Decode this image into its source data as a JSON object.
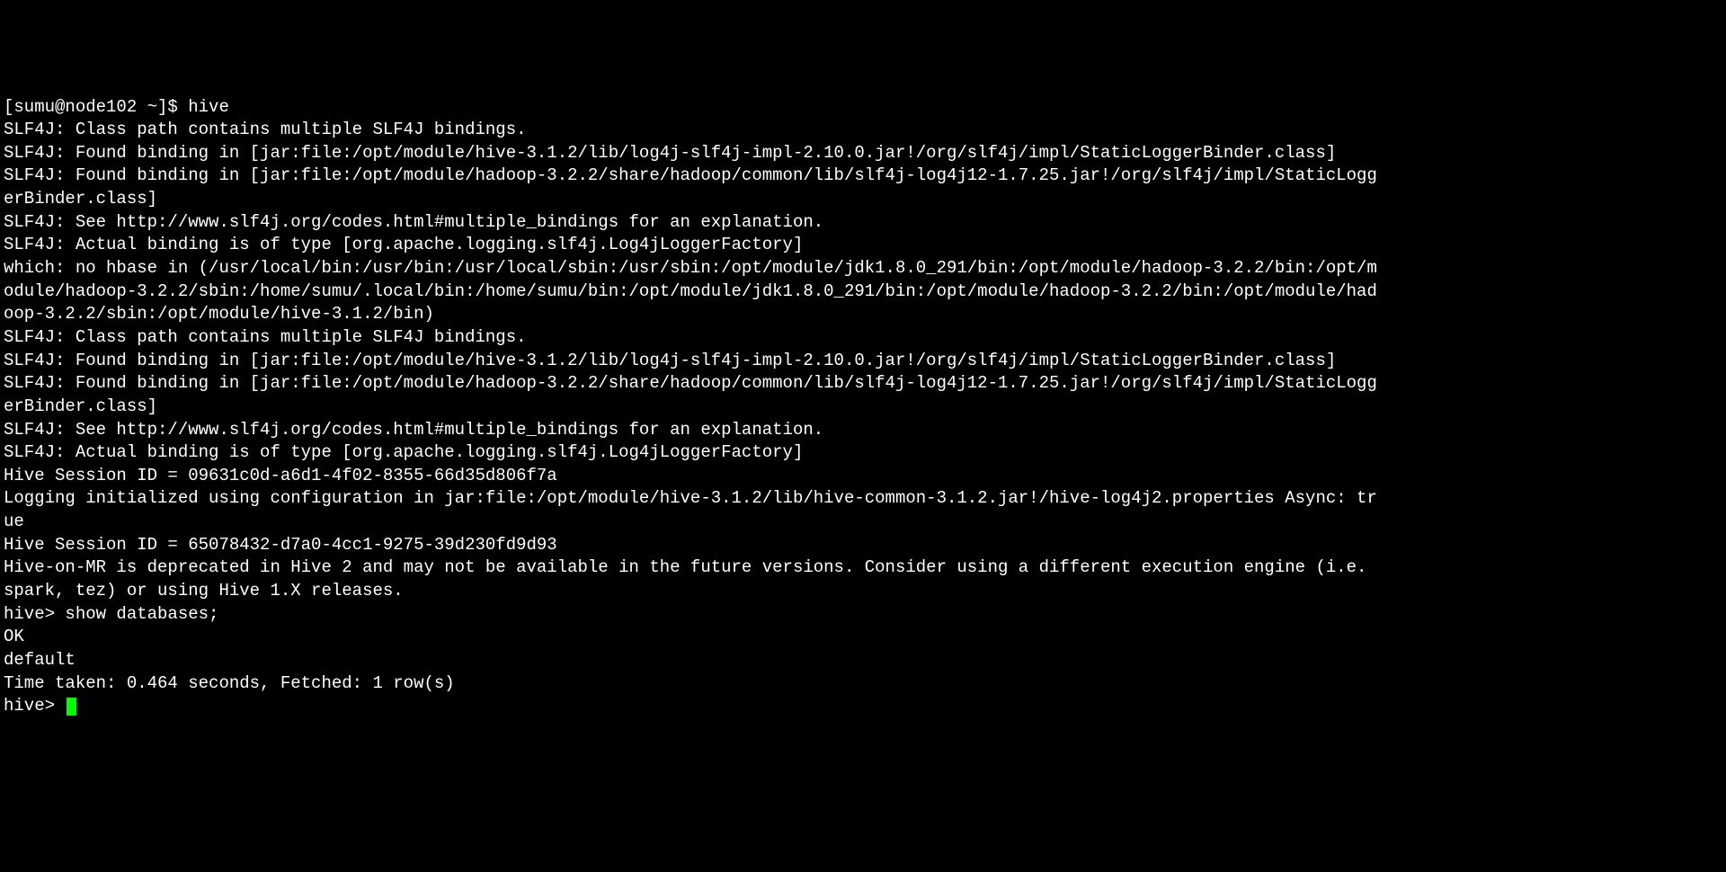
{
  "terminal": {
    "lines": [
      "[sumu@node102 ~]$ hive",
      "SLF4J: Class path contains multiple SLF4J bindings.",
      "SLF4J: Found binding in [jar:file:/opt/module/hive-3.1.2/lib/log4j-slf4j-impl-2.10.0.jar!/org/slf4j/impl/StaticLoggerBinder.class]",
      "SLF4J: Found binding in [jar:file:/opt/module/hadoop-3.2.2/share/hadoop/common/lib/slf4j-log4j12-1.7.25.jar!/org/slf4j/impl/StaticLoggerBinder.class]",
      "SLF4J: See http://www.slf4j.org/codes.html#multiple_bindings for an explanation.",
      "SLF4J: Actual binding is of type [org.apache.logging.slf4j.Log4jLoggerFactory]",
      "which: no hbase in (/usr/local/bin:/usr/bin:/usr/local/sbin:/usr/sbin:/opt/module/jdk1.8.0_291/bin:/opt/module/hadoop-3.2.2/bin:/opt/module/hadoop-3.2.2/sbin:/home/sumu/.local/bin:/home/sumu/bin:/opt/module/jdk1.8.0_291/bin:/opt/module/hadoop-3.2.2/bin:/opt/module/hadoop-3.2.2/sbin:/opt/module/hive-3.1.2/bin)",
      "SLF4J: Class path contains multiple SLF4J bindings.",
      "SLF4J: Found binding in [jar:file:/opt/module/hive-3.1.2/lib/log4j-slf4j-impl-2.10.0.jar!/org/slf4j/impl/StaticLoggerBinder.class]",
      "SLF4J: Found binding in [jar:file:/opt/module/hadoop-3.2.2/share/hadoop/common/lib/slf4j-log4j12-1.7.25.jar!/org/slf4j/impl/StaticLoggerBinder.class]",
      "SLF4J: See http://www.slf4j.org/codes.html#multiple_bindings for an explanation.",
      "SLF4J: Actual binding is of type [org.apache.logging.slf4j.Log4jLoggerFactory]",
      "Hive Session ID = 09631c0d-a6d1-4f02-8355-66d35d806f7a",
      "",
      "Logging initialized using configuration in jar:file:/opt/module/hive-3.1.2/lib/hive-common-3.1.2.jar!/hive-log4j2.properties Async: true",
      "Hive Session ID = 65078432-d7a0-4cc1-9275-39d230fd9d93",
      "Hive-on-MR is deprecated in Hive 2 and may not be available in the future versions. Consider using a different execution engine (i.e. spark, tez) or using Hive 1.X releases.",
      "hive> show databases;",
      "OK",
      "default",
      "Time taken: 0.464 seconds, Fetched: 1 row(s)"
    ],
    "prompt": "hive> "
  }
}
